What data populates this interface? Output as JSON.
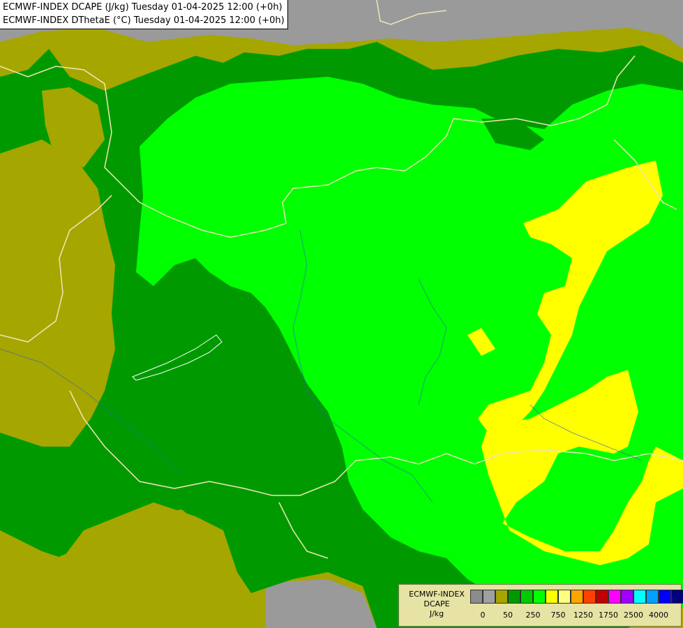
{
  "header": {
    "line1": "ECMWF-INDEX DCAPE (J/kg) Tuesday 01-04-2025 12:00 (+0h)",
    "line2": "ECMWF-INDEX DThetaE (°C) Tuesday 01-04-2025 12:00 (+0h)"
  },
  "legend": {
    "title_line1": "ECMWF-INDEX",
    "title_line2": "DCAPE",
    "unit": "J/kg",
    "colors": [
      "#8c8c8c",
      "#a0a0a0",
      "#a8a400",
      "#009a00",
      "#00cc00",
      "#00ff00",
      "#ffff00",
      "#ffff80",
      "#ffa500",
      "#ff4000",
      "#c00000",
      "#ff00ff",
      "#a000ff",
      "#00ffff",
      "#00a0ff",
      "#0000ff",
      "#00007a"
    ],
    "ticks": [
      "0",
      "50",
      "250",
      "750",
      "1250",
      "1750",
      "2500",
      "4000"
    ]
  },
  "map_colors": {
    "no_data_gray": "#9a9a9a",
    "olive": "#a6a600",
    "dark_green": "#009a00",
    "bright_green": "#00ff00",
    "yellow": "#ffff00",
    "border": "#f0e6b8"
  }
}
